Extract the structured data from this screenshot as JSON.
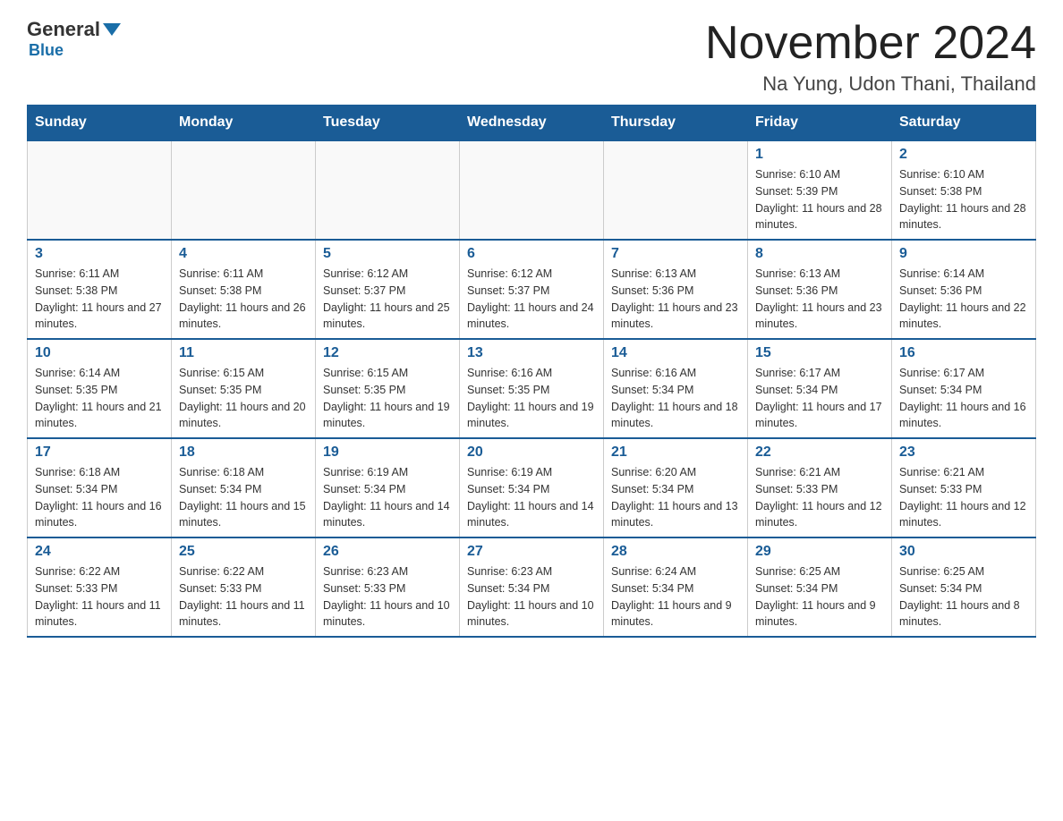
{
  "header": {
    "logo": {
      "general": "General",
      "blue": "Blue"
    },
    "title": "November 2024",
    "location": "Na Yung, Udon Thani, Thailand"
  },
  "weekdays": [
    "Sunday",
    "Monday",
    "Tuesday",
    "Wednesday",
    "Thursday",
    "Friday",
    "Saturday"
  ],
  "weeks": [
    [
      {
        "day": "",
        "info": ""
      },
      {
        "day": "",
        "info": ""
      },
      {
        "day": "",
        "info": ""
      },
      {
        "day": "",
        "info": ""
      },
      {
        "day": "",
        "info": ""
      },
      {
        "day": "1",
        "info": "Sunrise: 6:10 AM\nSunset: 5:39 PM\nDaylight: 11 hours and 28 minutes."
      },
      {
        "day": "2",
        "info": "Sunrise: 6:10 AM\nSunset: 5:38 PM\nDaylight: 11 hours and 28 minutes."
      }
    ],
    [
      {
        "day": "3",
        "info": "Sunrise: 6:11 AM\nSunset: 5:38 PM\nDaylight: 11 hours and 27 minutes."
      },
      {
        "day": "4",
        "info": "Sunrise: 6:11 AM\nSunset: 5:38 PM\nDaylight: 11 hours and 26 minutes."
      },
      {
        "day": "5",
        "info": "Sunrise: 6:12 AM\nSunset: 5:37 PM\nDaylight: 11 hours and 25 minutes."
      },
      {
        "day": "6",
        "info": "Sunrise: 6:12 AM\nSunset: 5:37 PM\nDaylight: 11 hours and 24 minutes."
      },
      {
        "day": "7",
        "info": "Sunrise: 6:13 AM\nSunset: 5:36 PM\nDaylight: 11 hours and 23 minutes."
      },
      {
        "day": "8",
        "info": "Sunrise: 6:13 AM\nSunset: 5:36 PM\nDaylight: 11 hours and 23 minutes."
      },
      {
        "day": "9",
        "info": "Sunrise: 6:14 AM\nSunset: 5:36 PM\nDaylight: 11 hours and 22 minutes."
      }
    ],
    [
      {
        "day": "10",
        "info": "Sunrise: 6:14 AM\nSunset: 5:35 PM\nDaylight: 11 hours and 21 minutes."
      },
      {
        "day": "11",
        "info": "Sunrise: 6:15 AM\nSunset: 5:35 PM\nDaylight: 11 hours and 20 minutes."
      },
      {
        "day": "12",
        "info": "Sunrise: 6:15 AM\nSunset: 5:35 PM\nDaylight: 11 hours and 19 minutes."
      },
      {
        "day": "13",
        "info": "Sunrise: 6:16 AM\nSunset: 5:35 PM\nDaylight: 11 hours and 19 minutes."
      },
      {
        "day": "14",
        "info": "Sunrise: 6:16 AM\nSunset: 5:34 PM\nDaylight: 11 hours and 18 minutes."
      },
      {
        "day": "15",
        "info": "Sunrise: 6:17 AM\nSunset: 5:34 PM\nDaylight: 11 hours and 17 minutes."
      },
      {
        "day": "16",
        "info": "Sunrise: 6:17 AM\nSunset: 5:34 PM\nDaylight: 11 hours and 16 minutes."
      }
    ],
    [
      {
        "day": "17",
        "info": "Sunrise: 6:18 AM\nSunset: 5:34 PM\nDaylight: 11 hours and 16 minutes."
      },
      {
        "day": "18",
        "info": "Sunrise: 6:18 AM\nSunset: 5:34 PM\nDaylight: 11 hours and 15 minutes."
      },
      {
        "day": "19",
        "info": "Sunrise: 6:19 AM\nSunset: 5:34 PM\nDaylight: 11 hours and 14 minutes."
      },
      {
        "day": "20",
        "info": "Sunrise: 6:19 AM\nSunset: 5:34 PM\nDaylight: 11 hours and 14 minutes."
      },
      {
        "day": "21",
        "info": "Sunrise: 6:20 AM\nSunset: 5:34 PM\nDaylight: 11 hours and 13 minutes."
      },
      {
        "day": "22",
        "info": "Sunrise: 6:21 AM\nSunset: 5:33 PM\nDaylight: 11 hours and 12 minutes."
      },
      {
        "day": "23",
        "info": "Sunrise: 6:21 AM\nSunset: 5:33 PM\nDaylight: 11 hours and 12 minutes."
      }
    ],
    [
      {
        "day": "24",
        "info": "Sunrise: 6:22 AM\nSunset: 5:33 PM\nDaylight: 11 hours and 11 minutes."
      },
      {
        "day": "25",
        "info": "Sunrise: 6:22 AM\nSunset: 5:33 PM\nDaylight: 11 hours and 11 minutes."
      },
      {
        "day": "26",
        "info": "Sunrise: 6:23 AM\nSunset: 5:33 PM\nDaylight: 11 hours and 10 minutes."
      },
      {
        "day": "27",
        "info": "Sunrise: 6:23 AM\nSunset: 5:34 PM\nDaylight: 11 hours and 10 minutes."
      },
      {
        "day": "28",
        "info": "Sunrise: 6:24 AM\nSunset: 5:34 PM\nDaylight: 11 hours and 9 minutes."
      },
      {
        "day": "29",
        "info": "Sunrise: 6:25 AM\nSunset: 5:34 PM\nDaylight: 11 hours and 9 minutes."
      },
      {
        "day": "30",
        "info": "Sunrise: 6:25 AM\nSunset: 5:34 PM\nDaylight: 11 hours and 8 minutes."
      }
    ]
  ]
}
